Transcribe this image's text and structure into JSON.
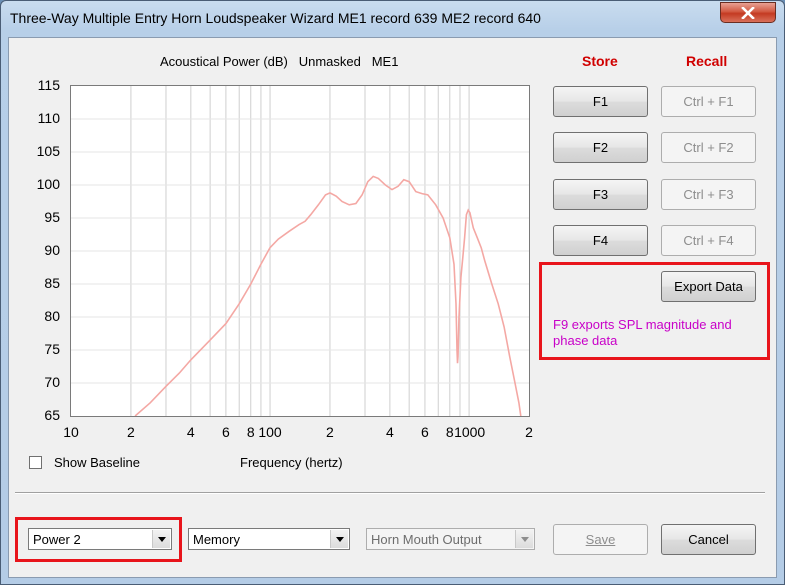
{
  "window": {
    "title": "Three-Way Multiple Entry Horn Loudspeaker Wizard    ME1 record 639    ME2 record 640"
  },
  "chart": {
    "title": "Acoustical Power (dB)   Unmasked   ME1",
    "x_label": "Frequency (hertz)"
  },
  "chart_data": {
    "type": "line",
    "title": "Acoustical Power (dB)   Unmasked   ME1",
    "xlabel": "Frequency (hertz)",
    "ylabel": "",
    "xscale": "log",
    "xlim": [
      10,
      2000
    ],
    "ylim": [
      65,
      115
    ],
    "y_ticks": [
      "115",
      "110",
      "105",
      "100",
      "95",
      "90",
      "85",
      "80",
      "75",
      "70",
      "65"
    ],
    "x_ticks": [
      "10",
      "2",
      "4",
      "6",
      "8",
      "100",
      "2",
      "4",
      "6",
      "8",
      "1000",
      "2"
    ],
    "grid": true,
    "line_color": "#f4a8a4",
    "series": [
      {
        "points": [
          [
            21,
            65
          ],
          [
            25,
            67
          ],
          [
            30,
            69.5
          ],
          [
            35,
            71.5
          ],
          [
            40,
            73.5
          ],
          [
            50,
            76.5
          ],
          [
            60,
            79
          ],
          [
            70,
            82
          ],
          [
            80,
            85
          ],
          [
            90,
            88
          ],
          [
            100,
            90.5
          ],
          [
            110,
            91.8
          ],
          [
            125,
            93
          ],
          [
            140,
            94
          ],
          [
            150,
            94.5
          ],
          [
            160,
            95.5
          ],
          [
            175,
            97
          ],
          [
            190,
            98.5
          ],
          [
            200,
            98.8
          ],
          [
            215,
            98.3
          ],
          [
            230,
            97.5
          ],
          [
            250,
            97
          ],
          [
            270,
            97.2
          ],
          [
            290,
            98.5
          ],
          [
            310,
            100.5
          ],
          [
            330,
            101.3
          ],
          [
            350,
            101
          ],
          [
            380,
            100
          ],
          [
            410,
            99.3
          ],
          [
            440,
            99.8
          ],
          [
            470,
            100.8
          ],
          [
            500,
            100.5
          ],
          [
            540,
            99
          ],
          [
            580,
            98.7
          ],
          [
            620,
            98.5
          ],
          [
            680,
            97
          ],
          [
            740,
            95
          ],
          [
            800,
            92
          ],
          [
            840,
            88
          ],
          [
            860,
            82
          ],
          [
            870,
            75
          ],
          [
            875,
            73
          ],
          [
            880,
            74
          ],
          [
            890,
            80
          ],
          [
            910,
            86
          ],
          [
            930,
            89
          ],
          [
            950,
            92
          ],
          [
            970,
            95.5
          ],
          [
            990,
            96.2
          ],
          [
            1010,
            95.8
          ],
          [
            1050,
            93.5
          ],
          [
            1100,
            92
          ],
          [
            1150,
            90.5
          ],
          [
            1200,
            88.5
          ],
          [
            1300,
            85
          ],
          [
            1400,
            82
          ],
          [
            1500,
            78.5
          ],
          [
            1600,
            74
          ],
          [
            1700,
            70
          ],
          [
            1780,
            67
          ],
          [
            1820,
            65
          ]
        ]
      }
    ]
  },
  "buttons": {
    "store_header": "Store",
    "recall_header": "Recall",
    "f1": "F1",
    "f2": "F2",
    "f3": "F3",
    "f4": "F4",
    "ctrl_f1": "Ctrl + F1",
    "ctrl_f2": "Ctrl + F2",
    "ctrl_f3": "Ctrl + F3",
    "ctrl_f4": "Ctrl + F4",
    "export": "Export Data",
    "save": "Save",
    "cancel": "Cancel"
  },
  "export_note": "F9 exports SPL magnitude and phase data",
  "baseline": {
    "label": "Show Baseline",
    "checked": false
  },
  "dropdowns": {
    "power": "Power 2",
    "memory": "Memory",
    "output": "Horn Mouth Output"
  },
  "colors": {
    "highlight_box": "#e8141b",
    "store_recall": "#d00000",
    "note": "#c800c8",
    "curve": "#f4a8a4"
  }
}
